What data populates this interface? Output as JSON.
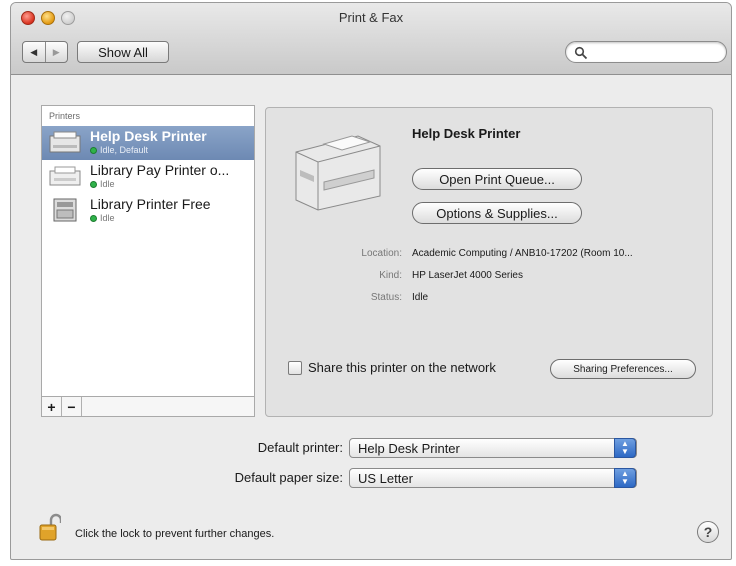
{
  "window": {
    "title": "Print & Fax"
  },
  "toolbar": {
    "back": "◀",
    "forward": "▶",
    "show_all_label": "Show All",
    "search_placeholder": ""
  },
  "printers": {
    "header": "Printers",
    "items": [
      {
        "name": "Help Desk Printer",
        "status": "Idle, Default",
        "selected": true
      },
      {
        "name": "Library Pay Printer o...",
        "status": "Idle",
        "selected": false
      },
      {
        "name": "Library Printer Free",
        "status": "Idle",
        "selected": false
      }
    ],
    "add_label": "+",
    "remove_label": "−"
  },
  "detail": {
    "name": "Help Desk Printer",
    "open_queue_label": "Open Print Queue...",
    "options_label": "Options & Supplies...",
    "location_label": "Location:",
    "location_value": "Academic Computing / ANB10-17202 (Room 10...",
    "kind_label": "Kind:",
    "kind_value": "HP LaserJet 4000 Series",
    "status_label": "Status:",
    "status_value": "Idle",
    "share_label": "Share this printer on the network",
    "share_checked": false,
    "sharing_prefs_label": "Sharing Preferences..."
  },
  "defaults": {
    "printer_label": "Default printer:",
    "printer_value": "Help Desk Printer",
    "paper_label": "Default paper size:",
    "paper_value": "US Letter"
  },
  "footer": {
    "lock_text": "Click the lock to prevent further changes.",
    "help_label": "?"
  },
  "colors": {
    "selection": "#7a95bd",
    "status_dot": "#2fb24a",
    "popup_accent": "#2d68c4"
  }
}
